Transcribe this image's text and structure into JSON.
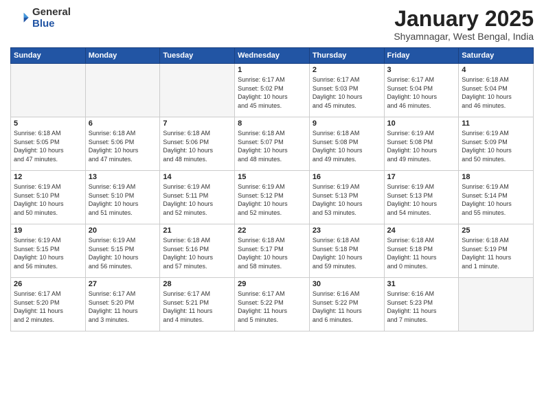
{
  "logo": {
    "general": "General",
    "blue": "Blue"
  },
  "title": "January 2025",
  "location": "Shyamnagar, West Bengal, India",
  "days_header": [
    "Sunday",
    "Monday",
    "Tuesday",
    "Wednesday",
    "Thursday",
    "Friday",
    "Saturday"
  ],
  "weeks": [
    [
      {
        "day": "",
        "info": ""
      },
      {
        "day": "",
        "info": ""
      },
      {
        "day": "",
        "info": ""
      },
      {
        "day": "1",
        "info": "Sunrise: 6:17 AM\nSunset: 5:02 PM\nDaylight: 10 hours\nand 45 minutes."
      },
      {
        "day": "2",
        "info": "Sunrise: 6:17 AM\nSunset: 5:03 PM\nDaylight: 10 hours\nand 45 minutes."
      },
      {
        "day": "3",
        "info": "Sunrise: 6:17 AM\nSunset: 5:04 PM\nDaylight: 10 hours\nand 46 minutes."
      },
      {
        "day": "4",
        "info": "Sunrise: 6:18 AM\nSunset: 5:04 PM\nDaylight: 10 hours\nand 46 minutes."
      }
    ],
    [
      {
        "day": "5",
        "info": "Sunrise: 6:18 AM\nSunset: 5:05 PM\nDaylight: 10 hours\nand 47 minutes."
      },
      {
        "day": "6",
        "info": "Sunrise: 6:18 AM\nSunset: 5:06 PM\nDaylight: 10 hours\nand 47 minutes."
      },
      {
        "day": "7",
        "info": "Sunrise: 6:18 AM\nSunset: 5:06 PM\nDaylight: 10 hours\nand 48 minutes."
      },
      {
        "day": "8",
        "info": "Sunrise: 6:18 AM\nSunset: 5:07 PM\nDaylight: 10 hours\nand 48 minutes."
      },
      {
        "day": "9",
        "info": "Sunrise: 6:18 AM\nSunset: 5:08 PM\nDaylight: 10 hours\nand 49 minutes."
      },
      {
        "day": "10",
        "info": "Sunrise: 6:19 AM\nSunset: 5:08 PM\nDaylight: 10 hours\nand 49 minutes."
      },
      {
        "day": "11",
        "info": "Sunrise: 6:19 AM\nSunset: 5:09 PM\nDaylight: 10 hours\nand 50 minutes."
      }
    ],
    [
      {
        "day": "12",
        "info": "Sunrise: 6:19 AM\nSunset: 5:10 PM\nDaylight: 10 hours\nand 50 minutes."
      },
      {
        "day": "13",
        "info": "Sunrise: 6:19 AM\nSunset: 5:10 PM\nDaylight: 10 hours\nand 51 minutes."
      },
      {
        "day": "14",
        "info": "Sunrise: 6:19 AM\nSunset: 5:11 PM\nDaylight: 10 hours\nand 52 minutes."
      },
      {
        "day": "15",
        "info": "Sunrise: 6:19 AM\nSunset: 5:12 PM\nDaylight: 10 hours\nand 52 minutes."
      },
      {
        "day": "16",
        "info": "Sunrise: 6:19 AM\nSunset: 5:13 PM\nDaylight: 10 hours\nand 53 minutes."
      },
      {
        "day": "17",
        "info": "Sunrise: 6:19 AM\nSunset: 5:13 PM\nDaylight: 10 hours\nand 54 minutes."
      },
      {
        "day": "18",
        "info": "Sunrise: 6:19 AM\nSunset: 5:14 PM\nDaylight: 10 hours\nand 55 minutes."
      }
    ],
    [
      {
        "day": "19",
        "info": "Sunrise: 6:19 AM\nSunset: 5:15 PM\nDaylight: 10 hours\nand 56 minutes."
      },
      {
        "day": "20",
        "info": "Sunrise: 6:19 AM\nSunset: 5:15 PM\nDaylight: 10 hours\nand 56 minutes."
      },
      {
        "day": "21",
        "info": "Sunrise: 6:18 AM\nSunset: 5:16 PM\nDaylight: 10 hours\nand 57 minutes."
      },
      {
        "day": "22",
        "info": "Sunrise: 6:18 AM\nSunset: 5:17 PM\nDaylight: 10 hours\nand 58 minutes."
      },
      {
        "day": "23",
        "info": "Sunrise: 6:18 AM\nSunset: 5:18 PM\nDaylight: 10 hours\nand 59 minutes."
      },
      {
        "day": "24",
        "info": "Sunrise: 6:18 AM\nSunset: 5:18 PM\nDaylight: 11 hours\nand 0 minutes."
      },
      {
        "day": "25",
        "info": "Sunrise: 6:18 AM\nSunset: 5:19 PM\nDaylight: 11 hours\nand 1 minute."
      }
    ],
    [
      {
        "day": "26",
        "info": "Sunrise: 6:17 AM\nSunset: 5:20 PM\nDaylight: 11 hours\nand 2 minutes."
      },
      {
        "day": "27",
        "info": "Sunrise: 6:17 AM\nSunset: 5:20 PM\nDaylight: 11 hours\nand 3 minutes."
      },
      {
        "day": "28",
        "info": "Sunrise: 6:17 AM\nSunset: 5:21 PM\nDaylight: 11 hours\nand 4 minutes."
      },
      {
        "day": "29",
        "info": "Sunrise: 6:17 AM\nSunset: 5:22 PM\nDaylight: 11 hours\nand 5 minutes."
      },
      {
        "day": "30",
        "info": "Sunrise: 6:16 AM\nSunset: 5:22 PM\nDaylight: 11 hours\nand 6 minutes."
      },
      {
        "day": "31",
        "info": "Sunrise: 6:16 AM\nSunset: 5:23 PM\nDaylight: 11 hours\nand 7 minutes."
      },
      {
        "day": "",
        "info": ""
      }
    ]
  ]
}
